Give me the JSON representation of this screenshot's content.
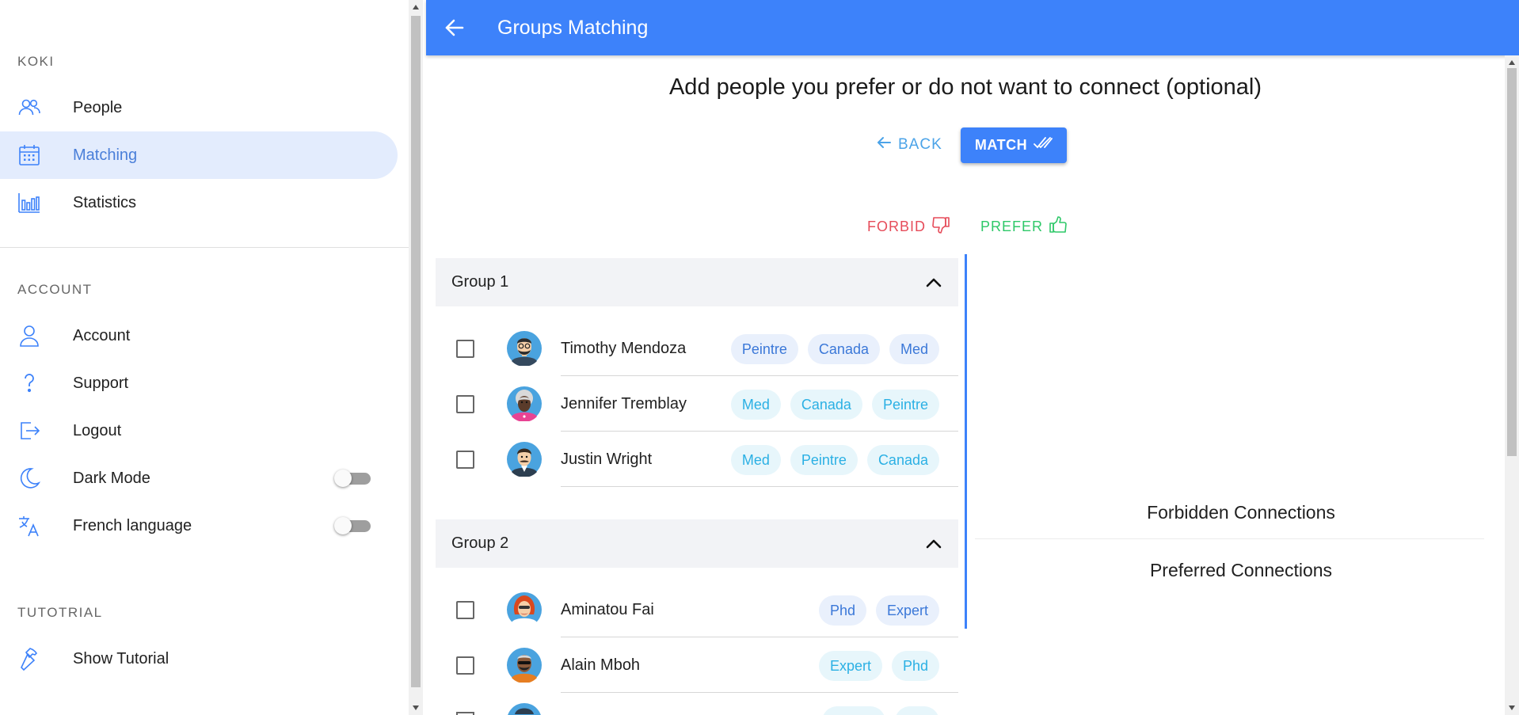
{
  "sidebar": {
    "sections": {
      "koki": "KOKI",
      "account": "ACCOUNT",
      "tutorial": "TUTOTRIAL"
    },
    "items": [
      {
        "label": "People",
        "icon": "people-icon"
      },
      {
        "label": "Matching",
        "icon": "calendar-icon",
        "active": true
      },
      {
        "label": "Statistics",
        "icon": "bar-chart-icon"
      },
      {
        "label": "Account",
        "icon": "person-icon"
      },
      {
        "label": "Support",
        "icon": "question-icon"
      },
      {
        "label": "Logout",
        "icon": "logout-icon"
      },
      {
        "label": "Dark Mode",
        "icon": "moon-icon",
        "toggle": false
      },
      {
        "label": "French language",
        "icon": "translate-icon",
        "toggle": false
      },
      {
        "label": "Show Tutorial",
        "icon": "hammer-icon"
      }
    ]
  },
  "appbar": {
    "title": "Groups Matching"
  },
  "main": {
    "heading": "Add people you prefer or do not want to connect (optional)",
    "back_label": "BACK",
    "match_label": "MATCH",
    "forbid_label": "FORBID",
    "prefer_label": "PREFER",
    "groups": [
      {
        "title": "Group 1",
        "people": [
          {
            "name": "Timothy Mendoza",
            "tags": [
              "Peintre",
              "Canada",
              "Med"
            ]
          },
          {
            "name": "Jennifer Tremblay",
            "tags": [
              "Med",
              "Canada",
              "Peintre"
            ]
          },
          {
            "name": "Justin Wright",
            "tags": [
              "Med",
              "Peintre",
              "Canada"
            ]
          }
        ]
      },
      {
        "title": "Group 2",
        "people": [
          {
            "name": "Aminatou Fai",
            "tags": [
              "Phd",
              "Expert"
            ]
          },
          {
            "name": "Alain Mboh",
            "tags": [
              "Expert",
              "Phd"
            ]
          }
        ]
      }
    ],
    "forbidden_label": "Forbidden Connections",
    "preferred_label": "Preferred Connections"
  },
  "colors": {
    "primary": "#3d82fa",
    "forbid": "#e64c5a",
    "prefer": "#2fc869",
    "active_bg": "#e3ecfd",
    "chip_blue": "#3b78d8",
    "chip_cyan": "#2bb0e4"
  }
}
